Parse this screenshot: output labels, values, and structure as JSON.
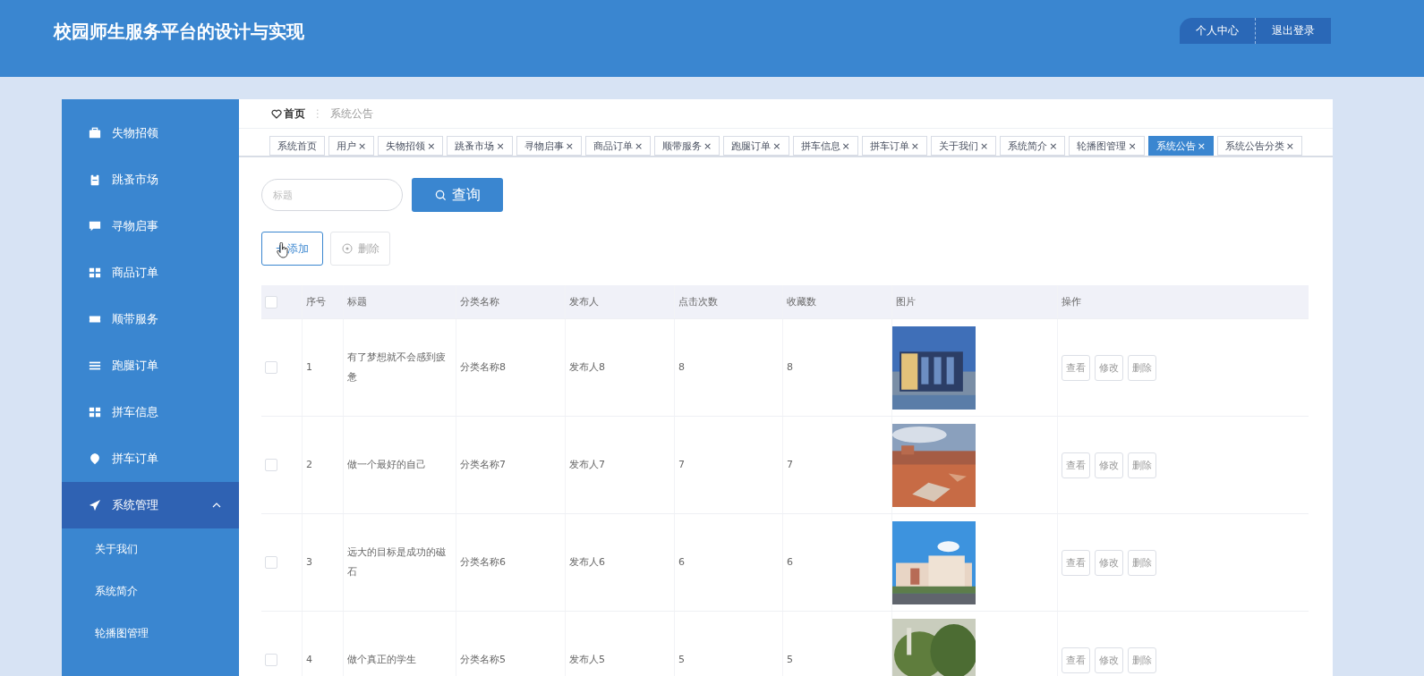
{
  "header": {
    "title": "校园师生服务平台的设计与实现",
    "buttons": [
      "个人中心",
      "退出登录"
    ]
  },
  "sidebar": {
    "items": [
      {
        "label": "失物招领",
        "selected": false
      },
      {
        "label": "跳蚤市场",
        "selected": false
      },
      {
        "label": "寻物启事",
        "selected": false
      },
      {
        "label": "商品订单",
        "selected": false
      },
      {
        "label": "顺带服务",
        "selected": false
      },
      {
        "label": "跑腿订单",
        "selected": false
      },
      {
        "label": "拼车信息",
        "selected": false
      },
      {
        "label": "拼车订单",
        "selected": false
      },
      {
        "label": "系统管理",
        "selected": true,
        "expanded": true,
        "children": [
          {
            "label": "关于我们"
          },
          {
            "label": "系统简介"
          },
          {
            "label": "轮播图管理"
          }
        ]
      }
    ]
  },
  "breadcrumb": {
    "home": "首页",
    "separator": "⋮",
    "current": "系统公告"
  },
  "tabs": [
    {
      "label": "系统首页",
      "selected": false
    },
    {
      "label": "用户",
      "close": "×",
      "selected": false
    },
    {
      "label": "失物招领",
      "close": "×",
      "selected": false
    },
    {
      "label": "跳蚤市场",
      "close": "×",
      "selected": false
    },
    {
      "label": "寻物启事",
      "close": "×",
      "selected": false
    },
    {
      "label": "商品订单",
      "close": "×",
      "selected": false
    },
    {
      "label": "顺带服务",
      "close": "×",
      "selected": false
    },
    {
      "label": "跑腿订单",
      "close": "×",
      "selected": false
    },
    {
      "label": "拼车信息",
      "close": "×",
      "selected": false
    },
    {
      "label": "拼车订单",
      "close": "×",
      "selected": false
    },
    {
      "label": "关于我们",
      "close": "×",
      "selected": false
    },
    {
      "label": "系统简介",
      "close": "×",
      "selected": false
    },
    {
      "label": "轮播图管理",
      "close": "×",
      "selected": false
    },
    {
      "label": "系统公告",
      "close": "×",
      "selected": true
    },
    {
      "label": "系统公告分类",
      "close": "×",
      "selected": false
    }
  ],
  "search": {
    "placeholder": "标题",
    "button": "查询"
  },
  "toolbar": {
    "add": "+ 添加",
    "delete": "删除"
  },
  "table": {
    "header_checked": false,
    "columns": [
      "序号",
      "标题",
      "分类名称",
      "发布人",
      "点击次数",
      "收藏数",
      "图片",
      "操作"
    ],
    "rows": [
      {
        "checked": false,
        "cells": [
          "1",
          "有了梦想就不会感到疲惫",
          "分类名称8",
          "发布人8",
          "8",
          "8"
        ],
        "picture": {
          "kind": "picture"
        },
        "actions": [
          "查看",
          "修改",
          "删除"
        ]
      },
      {
        "checked": false,
        "cells": [
          "2",
          "做一个最好的自己",
          "分类名称7",
          "发布人7",
          "7",
          "7"
        ],
        "picture": {
          "kind": "picture"
        },
        "actions": [
          "查看",
          "修改",
          "删除"
        ]
      },
      {
        "checked": false,
        "cells": [
          "3",
          "远大的目标是成功的磁石",
          "分类名称6",
          "发布人6",
          "6",
          "6"
        ],
        "picture": {
          "kind": "picture"
        },
        "actions": [
          "查看",
          "修改",
          "删除"
        ]
      },
      {
        "checked": false,
        "cells": [
          "4",
          "做个真正的学生",
          "分类名称5",
          "发布人5",
          "5",
          "5"
        ],
        "picture": {
          "kind": "picture"
        },
        "actions": [
          "查看",
          "修改",
          "删除"
        ]
      }
    ]
  }
}
